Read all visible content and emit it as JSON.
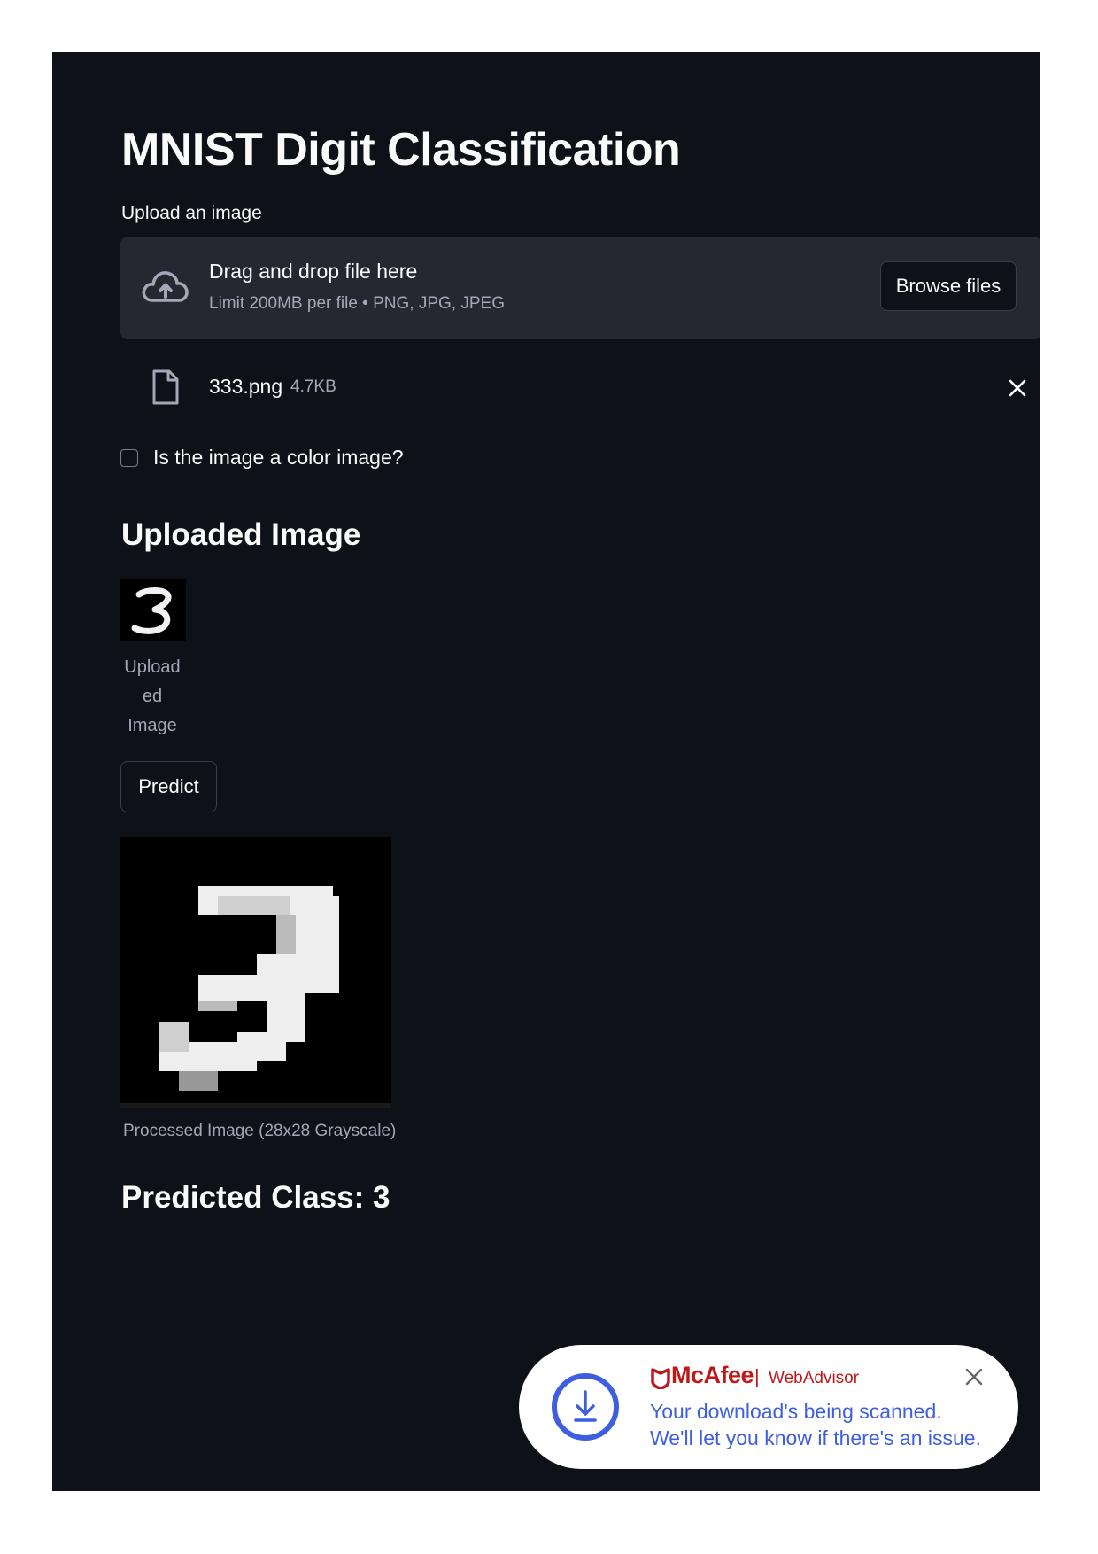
{
  "app": {
    "title": "MNIST Digit Classification"
  },
  "uploader": {
    "label": "Upload an image",
    "dropzone_title": "Drag and drop file here",
    "dropzone_subtitle": "Limit 200MB per file • PNG, JPG, JPEG",
    "browse_label": "Browse files",
    "file": {
      "name": "333.png",
      "size": "4.7KB"
    }
  },
  "options": {
    "color_checkbox_label": "Is the image a color image?",
    "color_checked": false
  },
  "uploaded": {
    "heading": "Uploaded Image",
    "caption_lines": [
      "Upload",
      "ed",
      "Image"
    ]
  },
  "predict": {
    "button_label": "Predict"
  },
  "processed": {
    "caption": "Processed Image (28x28 Grayscale)"
  },
  "result": {
    "text": "Predicted Class: 3"
  },
  "notification": {
    "brand": "McAfee",
    "product": "WebAdvisor",
    "separator": "|",
    "line1": "Your download's being scanned.",
    "line2": "We'll let you know if there's an issue."
  },
  "colors": {
    "background": "#0e1117",
    "surface": "#262730",
    "text": "#fafafa",
    "muted_text": "#a3a8b8",
    "brand_red": "#c01818",
    "notice_blue": "#3d5fe0"
  },
  "icons": [
    "cloud-upload-icon",
    "file-icon",
    "close-icon",
    "download-icon",
    "mcafee-shield-icon"
  ]
}
